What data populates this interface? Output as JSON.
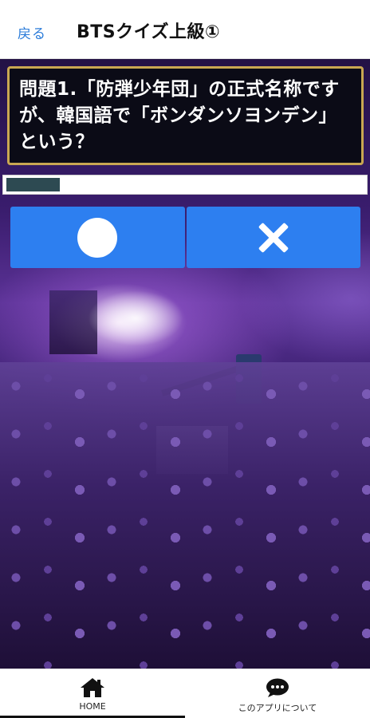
{
  "navbar": {
    "back_label": "戻る",
    "title": "BTSクイズ上級①"
  },
  "question": {
    "text": "問題1.「防弾少年団」の正式名称ですが、韓国語で「ボンダンソヨンデン」という？"
  },
  "progress": {
    "fraction": 0.15,
    "fill_color": "#2d4a52"
  },
  "answers": {
    "circle_icon": "circle-icon",
    "cross_icon": "cross-icon",
    "button_color": "#2d7ff0"
  },
  "tabbar": {
    "tabs": [
      {
        "label": "HOME",
        "icon": "home-icon",
        "active": true
      },
      {
        "label": "このアプリについて",
        "icon": "chat-bubble-icon",
        "active": false
      }
    ]
  },
  "colors": {
    "accent_link": "#2a7bd9",
    "question_border": "#c9a752"
  }
}
